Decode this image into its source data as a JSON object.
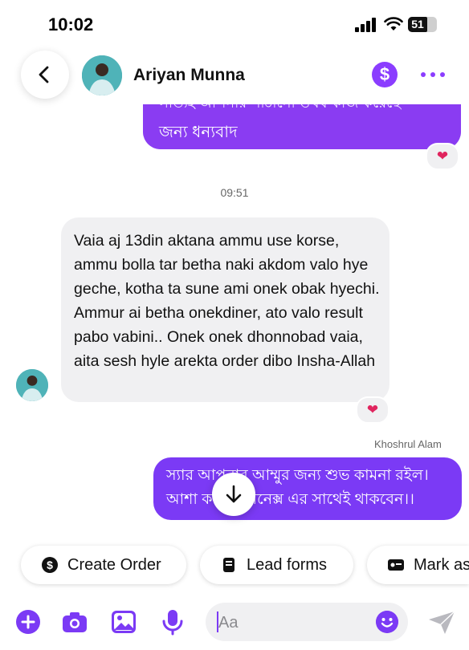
{
  "status_bar": {
    "time": "10:02",
    "battery": "51"
  },
  "header": {
    "contact_name": "Ariyan Munna"
  },
  "messages": {
    "top_outgoing_cut": "সত্যিই আপনার পাঠানো ঔষধ কাজ করেছে",
    "top_outgoing": "জন্য ধন্যবাদ",
    "top_reaction": "❤",
    "timestamp": "09:51",
    "incoming": "Vaia aj 13din aktana ammu use korse, ammu bolla tar betha naki akdom valo hye geche, kotha ta sune ami onek obak hyechi. Ammur ai betha onekdiner, ato valo result pabo vabini.. Onek onek dhonnobad vaia, aita sesh hyle arekta order dibo Insha-Allah",
    "incoming_reaction": "❤",
    "sender_name": "Khoshrul Alam",
    "bottom_outgoing": "স্যার আপনার আম্মুর জন্য শুভ কামনা রইল। আশা করি অর্গানেক্স এর সাথেই থাকবেন।।"
  },
  "quick_actions": [
    {
      "label": "Create Order",
      "icon": "dollar-icon"
    },
    {
      "label": "Lead forms",
      "icon": "form-icon"
    },
    {
      "label": "Mark as",
      "icon": "tag-icon"
    }
  ],
  "composer": {
    "placeholder": "Aa"
  },
  "colors": {
    "accent": "#8b3dff",
    "bubble_out": "#7b3af5",
    "bubble_in": "#f0f0f2"
  }
}
